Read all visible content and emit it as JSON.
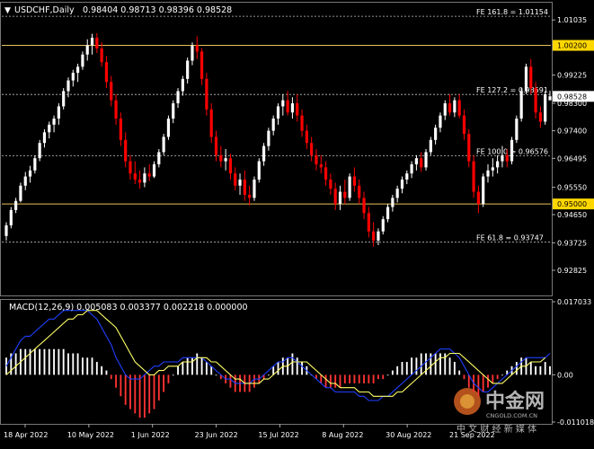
{
  "header": {
    "triangle": "▼",
    "symbol": "USDCHF,Daily",
    "ohlc": "0.98404 0.98713 0.98396 0.98528"
  },
  "macd_header": {
    "label": "MACD(12,26,9) 0.005083 0.003377 0.002218 0.000000"
  },
  "watermark": {
    "brand": "中金网",
    "domain": "CNGOLD.COM.CN",
    "tagline": "中 文 财 经 新 媒 体"
  },
  "colors": {
    "background": "#000000",
    "bull_candle": "#ffffff",
    "bear_candle": "#ff0000",
    "level_line": "#e8c35a",
    "fib_line": "#bfbfbf",
    "macd_line": "#1f3fff",
    "signal_line": "#ffff66",
    "hist_pos": "#ffffff",
    "hist_neg": "#ff3333",
    "current_price_bg": "#ffffff",
    "level_label_bg": "#ffd700"
  },
  "chart_data": [
    {
      "type": "candlestick",
      "symbol": "USDCHF",
      "timeframe": "Daily",
      "ylim": [
        0.92,
        1.016
      ],
      "x_tick_labels": [
        "18 Apr 2022",
        "10 May 2022",
        "1 Jun 2022",
        "23 Jun 2022",
        "15 Jul 2022",
        "8 Aug 2022",
        "30 Aug 2022",
        "21 Sep 2022"
      ],
      "y_tick_labels": [
        "1.01035",
        "0.99225",
        "0.98300",
        "0.97400",
        "0.96495",
        "0.95550",
        "0.94650",
        "0.93725",
        "0.92825"
      ],
      "current_price": "0.98528",
      "horizontal_levels": [
        {
          "value": 1.002,
          "label": "1.00200"
        },
        {
          "value": 0.95,
          "label": "0.95000"
        }
      ],
      "fib_levels": [
        {
          "label": "FE 161.8 = 1.01154",
          "value": 1.01154
        },
        {
          "label": "FE 127.2 = 0.98591",
          "value": 0.98591
        },
        {
          "label": "FE 100.0 = 0.96576",
          "value": 0.96576
        },
        {
          "label": "FE 61.8 = 0.93747",
          "value": 0.93747
        }
      ],
      "candles": [
        [
          0.9395,
          0.944,
          0.938,
          0.943
        ],
        [
          0.943,
          0.949,
          0.942,
          0.948
        ],
        [
          0.948,
          0.952,
          0.947,
          0.951
        ],
        [
          0.951,
          0.957,
          0.9505,
          0.956
        ],
        [
          0.956,
          0.9605,
          0.9545,
          0.959
        ],
        [
          0.959,
          0.9625,
          0.957,
          0.961
        ],
        [
          0.961,
          0.966,
          0.96,
          0.965
        ],
        [
          0.965,
          0.971,
          0.964,
          0.97
        ],
        [
          0.97,
          0.9745,
          0.9685,
          0.9735
        ],
        [
          0.9735,
          0.977,
          0.9715,
          0.976
        ],
        [
          0.976,
          0.979,
          0.9735,
          0.978
        ],
        [
          0.978,
          0.983,
          0.976,
          0.982
        ],
        [
          0.982,
          0.988,
          0.981,
          0.987
        ],
        [
          0.987,
          0.9915,
          0.985,
          0.9905
        ],
        [
          0.9905,
          0.994,
          0.9885,
          0.993
        ],
        [
          0.993,
          0.996,
          0.99,
          0.995
        ],
        [
          0.995,
          1.0,
          0.994,
          0.999
        ],
        [
          0.999,
          1.004,
          0.997,
          1.002
        ],
        [
          1.002,
          1.0058,
          0.999,
          1.0045
        ],
        [
          1.0045,
          1.006,
          0.9995,
          1.001
        ],
        [
          1.001,
          1.003,
          0.995,
          0.9965
        ],
        [
          0.9965,
          0.9985,
          0.988,
          0.99
        ],
        [
          0.99,
          0.992,
          0.982,
          0.984
        ],
        [
          0.984,
          0.986,
          0.976,
          0.978
        ],
        [
          0.978,
          0.98,
          0.969,
          0.971
        ],
        [
          0.971,
          0.9735,
          0.962,
          0.964
        ],
        [
          0.964,
          0.966,
          0.958,
          0.96
        ],
        [
          0.96,
          0.964,
          0.9565,
          0.958
        ],
        [
          0.958,
          0.961,
          0.955,
          0.957
        ],
        [
          0.957,
          0.962,
          0.9555,
          0.96
        ],
        [
          0.96,
          0.963,
          0.9575,
          0.959
        ],
        [
          0.959,
          0.964,
          0.9585,
          0.963
        ],
        [
          0.963,
          0.968,
          0.962,
          0.967
        ],
        [
          0.967,
          0.973,
          0.966,
          0.972
        ],
        [
          0.972,
          0.979,
          0.971,
          0.978
        ],
        [
          0.978,
          0.984,
          0.9765,
          0.983
        ],
        [
          0.983,
          0.988,
          0.9815,
          0.987
        ],
        [
          0.987,
          0.992,
          0.9855,
          0.991
        ],
        [
          0.991,
          0.998,
          0.9895,
          0.997
        ],
        [
          0.997,
          1.003,
          0.9955,
          1.002
        ],
        [
          1.002,
          1.005,
          0.9975,
          1.0
        ],
        [
          1.0,
          1.001,
          0.989,
          0.991
        ],
        [
          0.991,
          0.993,
          0.979,
          0.981
        ],
        [
          0.981,
          0.983,
          0.97,
          0.972
        ],
        [
          0.972,
          0.974,
          0.964,
          0.966
        ],
        [
          0.966,
          0.969,
          0.962,
          0.964
        ],
        [
          0.964,
          0.968,
          0.961,
          0.965
        ],
        [
          0.965,
          0.9665,
          0.958,
          0.96
        ],
        [
          0.96,
          0.962,
          0.9545,
          0.956
        ],
        [
          0.956,
          0.96,
          0.953,
          0.958
        ],
        [
          0.958,
          0.961,
          0.951,
          0.953
        ],
        [
          0.953,
          0.956,
          0.9495,
          0.952
        ],
        [
          0.952,
          0.959,
          0.951,
          0.958
        ],
        [
          0.958,
          0.965,
          0.957,
          0.964
        ],
        [
          0.964,
          0.97,
          0.9625,
          0.969
        ],
        [
          0.969,
          0.975,
          0.9675,
          0.974
        ],
        [
          0.974,
          0.979,
          0.9725,
          0.978
        ],
        [
          0.978,
          0.983,
          0.976,
          0.982
        ],
        [
          0.982,
          0.986,
          0.979,
          0.984
        ],
        [
          0.984,
          0.987,
          0.979,
          0.98
        ],
        [
          0.98,
          0.985,
          0.978,
          0.983
        ],
        [
          0.983,
          0.986,
          0.977,
          0.979
        ],
        [
          0.979,
          0.981,
          0.972,
          0.974
        ],
        [
          0.974,
          0.976,
          0.968,
          0.97
        ],
        [
          0.97,
          0.972,
          0.964,
          0.966
        ],
        [
          0.966,
          0.968,
          0.961,
          0.963
        ],
        [
          0.963,
          0.966,
          0.96,
          0.962
        ],
        [
          0.962,
          0.964,
          0.956,
          0.958
        ],
        [
          0.958,
          0.96,
          0.953,
          0.955
        ],
        [
          0.955,
          0.957,
          0.948,
          0.95
        ],
        [
          0.95,
          0.956,
          0.948,
          0.954
        ],
        [
          0.954,
          0.958,
          0.95,
          0.952
        ],
        [
          0.952,
          0.96,
          0.951,
          0.959
        ],
        [
          0.959,
          0.962,
          0.954,
          0.956
        ],
        [
          0.956,
          0.958,
          0.95,
          0.952
        ],
        [
          0.952,
          0.954,
          0.945,
          0.947
        ],
        [
          0.947,
          0.949,
          0.939,
          0.941
        ],
        [
          0.941,
          0.944,
          0.936,
          0.938
        ],
        [
          0.938,
          0.942,
          0.9365,
          0.941
        ],
        [
          0.941,
          0.946,
          0.94,
          0.945
        ],
        [
          0.945,
          0.95,
          0.944,
          0.949
        ],
        [
          0.949,
          0.953,
          0.9475,
          0.952
        ],
        [
          0.952,
          0.956,
          0.9505,
          0.955
        ],
        [
          0.955,
          0.959,
          0.9535,
          0.958
        ],
        [
          0.958,
          0.961,
          0.9565,
          0.96
        ],
        [
          0.96,
          0.964,
          0.9585,
          0.963
        ],
        [
          0.963,
          0.966,
          0.961,
          0.965
        ],
        [
          0.965,
          0.967,
          0.9605,
          0.962
        ],
        [
          0.962,
          0.968,
          0.961,
          0.967
        ],
        [
          0.967,
          0.972,
          0.966,
          0.971
        ],
        [
          0.971,
          0.976,
          0.9695,
          0.975
        ],
        [
          0.975,
          0.98,
          0.9735,
          0.979
        ],
        [
          0.979,
          0.984,
          0.9775,
          0.983
        ],
        [
          0.983,
          0.986,
          0.979,
          0.98
        ],
        [
          0.98,
          0.985,
          0.9785,
          0.984
        ],
        [
          0.984,
          0.986,
          0.978,
          0.979
        ],
        [
          0.979,
          0.981,
          0.971,
          0.973
        ],
        [
          0.973,
          0.9745,
          0.962,
          0.964
        ],
        [
          0.964,
          0.966,
          0.952,
          0.954
        ],
        [
          0.954,
          0.956,
          0.947,
          0.95
        ],
        [
          0.95,
          0.96,
          0.949,
          0.959
        ],
        [
          0.959,
          0.963,
          0.957,
          0.961
        ],
        [
          0.961,
          0.965,
          0.959,
          0.962
        ],
        [
          0.962,
          0.966,
          0.96,
          0.964
        ],
        [
          0.964,
          0.969,
          0.962,
          0.966
        ],
        [
          0.966,
          0.968,
          0.962,
          0.964
        ],
        [
          0.964,
          0.972,
          0.963,
          0.971
        ],
        [
          0.971,
          0.979,
          0.97,
          0.978
        ],
        [
          0.978,
          0.988,
          0.977,
          0.987
        ],
        [
          0.987,
          0.996,
          0.986,
          0.995
        ],
        [
          0.995,
          0.9975,
          0.986,
          0.988
        ],
        [
          0.988,
          0.99,
          0.978,
          0.98
        ],
        [
          0.98,
          0.982,
          0.975,
          0.977
        ],
        [
          0.977,
          0.987,
          0.976,
          0.986
        ],
        [
          0.984,
          0.9871,
          0.984,
          0.9853
        ]
      ]
    },
    {
      "type": "bar",
      "name": "MACD(12,26,9)",
      "values_header": [
        "0.005083",
        "0.003377",
        "0.002218",
        "0.000000"
      ],
      "y_tick_labels": [
        "0.017033",
        "0.00",
        "-0.011018"
      ],
      "ylim": [
        -0.011018,
        0.017033
      ],
      "histogram": [
        0.004,
        0.005,
        0.005,
        0.006,
        0.006,
        0.006,
        0.006,
        0.006,
        0.006,
        0.006,
        0.006,
        0.006,
        0.006,
        0.005,
        0.005,
        0.005,
        0.004,
        0.004,
        0.004,
        0.003,
        0.002,
        0.001,
        -0.001,
        -0.003,
        -0.005,
        -0.007,
        -0.008,
        -0.009,
        -0.01,
        -0.01,
        -0.009,
        -0.008,
        -0.006,
        -0.004,
        -0.002,
        0.0,
        0.002,
        0.003,
        0.004,
        0.004,
        0.005,
        0.004,
        0.003,
        0.002,
        0.0,
        -0.001,
        -0.002,
        -0.003,
        -0.004,
        -0.004,
        -0.004,
        -0.004,
        -0.003,
        -0.002,
        -0.001,
        0.0,
        0.002,
        0.003,
        0.004,
        0.004,
        0.005,
        0.004,
        0.003,
        0.002,
        0.0,
        -0.001,
        -0.002,
        -0.003,
        -0.003,
        -0.003,
        -0.003,
        -0.002,
        -0.002,
        -0.002,
        -0.002,
        -0.002,
        -0.002,
        -0.002,
        -0.001,
        -0.001,
        0.0,
        0.001,
        0.002,
        0.003,
        0.003,
        0.004,
        0.004,
        0.005,
        0.005,
        0.005,
        0.005,
        0.005,
        0.005,
        0.004,
        0.003,
        0.001,
        -0.001,
        -0.003,
        -0.004,
        -0.005,
        -0.004,
        -0.003,
        -0.002,
        -0.001,
        0.0,
        0.001,
        0.002,
        0.003,
        0.004,
        0.004,
        0.003,
        0.002,
        0.002,
        0.003,
        0.002
      ],
      "macd_line": [
        0.002,
        0.004,
        0.006,
        0.008,
        0.009,
        0.009,
        0.01,
        0.011,
        0.012,
        0.013,
        0.013,
        0.014,
        0.015,
        0.015,
        0.015,
        0.015,
        0.015,
        0.015,
        0.014,
        0.013,
        0.011,
        0.009,
        0.007,
        0.004,
        0.002,
        0.0,
        -0.001,
        -0.001,
        -0.001,
        0.0,
        0.001,
        0.002,
        0.002,
        0.003,
        0.003,
        0.003,
        0.003,
        0.004,
        0.004,
        0.004,
        0.004,
        0.004,
        0.003,
        0.002,
        0.001,
        0.0,
        -0.001,
        -0.001,
        -0.002,
        -0.002,
        -0.002,
        -0.002,
        -0.001,
        -0.001,
        0.0,
        0.001,
        0.002,
        0.003,
        0.003,
        0.004,
        0.004,
        0.003,
        0.002,
        0.001,
        0.0,
        -0.001,
        -0.002,
        -0.003,
        -0.003,
        -0.004,
        -0.004,
        -0.004,
        -0.004,
        -0.004,
        -0.005,
        -0.005,
        -0.006,
        -0.006,
        -0.006,
        -0.005,
        -0.005,
        -0.004,
        -0.003,
        -0.002,
        -0.001,
        0.0,
        0.001,
        0.002,
        0.003,
        0.004,
        0.005,
        0.006,
        0.006,
        0.006,
        0.005,
        0.004,
        0.002,
        0.0,
        -0.002,
        -0.003,
        -0.004,
        -0.004,
        -0.003,
        -0.002,
        -0.001,
        0.0,
        0.001,
        0.002,
        0.003,
        0.004,
        0.004,
        0.004,
        0.004,
        0.004,
        0.005
      ],
      "signal_line": [
        0.0,
        0.001,
        0.002,
        0.003,
        0.004,
        0.005,
        0.006,
        0.007,
        0.008,
        0.009,
        0.01,
        0.011,
        0.012,
        0.013,
        0.013,
        0.014,
        0.014,
        0.015,
        0.015,
        0.015,
        0.014,
        0.013,
        0.012,
        0.011,
        0.009,
        0.007,
        0.005,
        0.003,
        0.002,
        0.001,
        0.0,
        0.0,
        0.001,
        0.001,
        0.002,
        0.002,
        0.002,
        0.003,
        0.003,
        0.003,
        0.004,
        0.004,
        0.004,
        0.003,
        0.003,
        0.002,
        0.001,
        0.0,
        -0.001,
        -0.001,
        -0.002,
        -0.002,
        -0.002,
        -0.002,
        -0.001,
        -0.001,
        0.0,
        0.001,
        0.002,
        0.002,
        0.003,
        0.003,
        0.003,
        0.003,
        0.002,
        0.001,
        0.0,
        -0.001,
        -0.002,
        -0.002,
        -0.003,
        -0.003,
        -0.003,
        -0.003,
        -0.004,
        -0.004,
        -0.004,
        -0.005,
        -0.005,
        -0.005,
        -0.005,
        -0.005,
        -0.004,
        -0.004,
        -0.003,
        -0.002,
        -0.001,
        0.0,
        0.001,
        0.002,
        0.003,
        0.004,
        0.004,
        0.005,
        0.005,
        0.005,
        0.004,
        0.003,
        0.002,
        0.001,
        0.0,
        -0.001,
        -0.002,
        -0.002,
        -0.002,
        -0.001,
        0.0,
        0.001,
        0.002,
        0.002,
        0.003,
        0.003,
        0.003,
        0.004
      ]
    }
  ]
}
